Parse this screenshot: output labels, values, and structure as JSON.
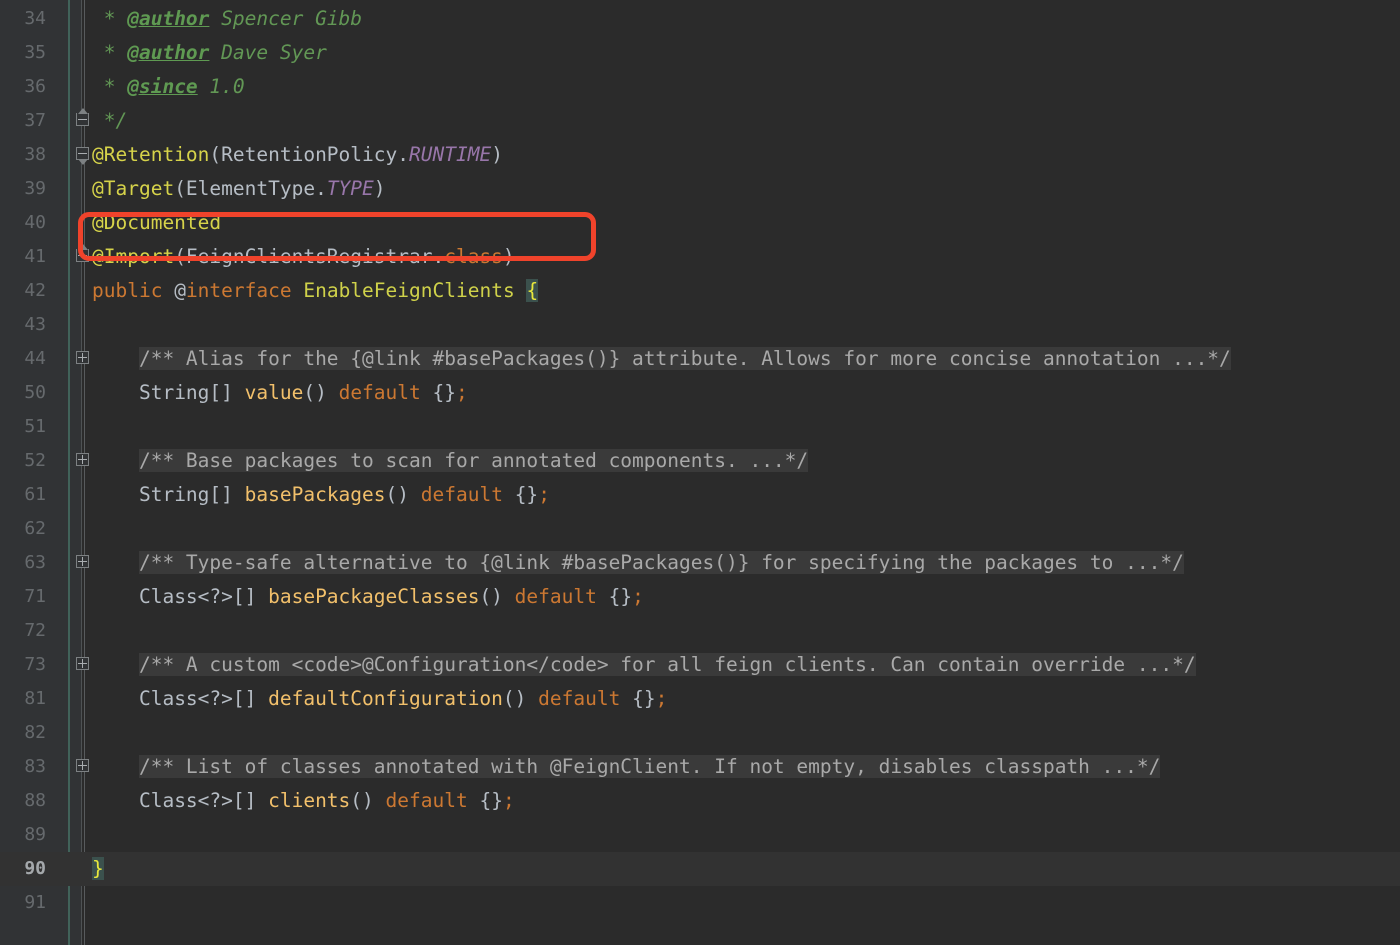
{
  "editor": {
    "file_language": "java",
    "theme": "darcula",
    "background": "#2b2b2b",
    "gutter_background": "#313335",
    "current_line_background": "#323232",
    "current_line_number": "90",
    "annotation_box_color": "#f0432b"
  },
  "lines": [
    {
      "number": "34",
      "fold": "none",
      "current": false,
      "text": " * @author Spencer Gibb",
      "tokens": [
        {
          "t": " * ",
          "c": "c-jdoctext"
        },
        {
          "t": "@author",
          "c": "c-jdoctag"
        },
        {
          "t": " Spencer Gibb",
          "c": "c-jdoctext"
        }
      ]
    },
    {
      "number": "35",
      "fold": "none",
      "current": false,
      "text": " * @author Dave Syer",
      "tokens": [
        {
          "t": " * ",
          "c": "c-jdoctext"
        },
        {
          "t": "@author",
          "c": "c-jdoctag"
        },
        {
          "t": " Dave Syer",
          "c": "c-jdoctext"
        }
      ]
    },
    {
      "number": "36",
      "fold": "none",
      "current": false,
      "text": " * @since 1.0",
      "tokens": [
        {
          "t": " * ",
          "c": "c-jdoctext"
        },
        {
          "t": "@since",
          "c": "c-jdoctag"
        },
        {
          "t": " 1.0",
          "c": "c-jdoctext"
        }
      ]
    },
    {
      "number": "37",
      "fold": "endfold",
      "current": false,
      "text": " */",
      "tokens": [
        {
          "t": " */",
          "c": "c-jdoctext"
        }
      ]
    },
    {
      "number": "38",
      "fold": "collapse",
      "current": false,
      "text": "@Retention(RetentionPolicy.RUNTIME)",
      "tokens": [
        {
          "t": "@Retention",
          "c": "c-annot"
        },
        {
          "t": "(RetentionPolicy.",
          "c": "c-ident"
        },
        {
          "t": "RUNTIME",
          "c": "c-static"
        },
        {
          "t": ")",
          "c": "c-ident"
        }
      ]
    },
    {
      "number": "39",
      "fold": "none",
      "current": false,
      "text": "@Target(ElementType.TYPE)",
      "tokens": [
        {
          "t": "@Target",
          "c": "c-annot"
        },
        {
          "t": "(ElementType.",
          "c": "c-ident"
        },
        {
          "t": "TYPE",
          "c": "c-static"
        },
        {
          "t": ")",
          "c": "c-ident"
        }
      ]
    },
    {
      "number": "40",
      "fold": "none",
      "current": false,
      "text": "@Documented",
      "tokens": [
        {
          "t": "@Documented",
          "c": "c-annot"
        }
      ]
    },
    {
      "number": "41",
      "fold": "endfold",
      "current": false,
      "text": "@Import(FeignClientsRegistrar.class)",
      "tokens": [
        {
          "t": "@Import",
          "c": "c-annot"
        },
        {
          "t": "(FeignClientsRegistrar.",
          "c": "c-ident"
        },
        {
          "t": "class",
          "c": "c-keyword"
        },
        {
          "t": ")",
          "c": "c-ident"
        }
      ]
    },
    {
      "number": "42",
      "fold": "none",
      "current": false,
      "text": "public @interface EnableFeignClients {",
      "tokens": [
        {
          "t": "public ",
          "c": "c-keyword"
        },
        {
          "t": "@",
          "c": "c-ident"
        },
        {
          "t": "interface",
          "c": "c-keyword"
        },
        {
          "t": " ",
          "c": "c-ident"
        },
        {
          "t": "EnableFeignClients",
          "c": "c-classname"
        },
        {
          "t": " ",
          "c": "c-ident"
        },
        {
          "t": "{",
          "c": "c-brace-match"
        }
      ]
    },
    {
      "number": "43",
      "fold": "none",
      "current": false,
      "text": "",
      "tokens": []
    },
    {
      "number": "44",
      "fold": "plus",
      "current": false,
      "text": "    /** Alias for the {@link #basePackages()} attribute. Allows for more concise annotation ...*/",
      "tokens": [
        {
          "t": "    ",
          "c": "c-punct"
        },
        {
          "t": "/** Alias for the {@link #basePackages()} attribute. Allows for more concise annotation ...*/",
          "c": "c-folded"
        }
      ]
    },
    {
      "number": "50",
      "fold": "none",
      "current": false,
      "text": "    String[] value() default {};",
      "tokens": [
        {
          "t": "    ",
          "c": "c-punct"
        },
        {
          "t": "String[] ",
          "c": "c-ident"
        },
        {
          "t": "value",
          "c": "c-method"
        },
        {
          "t": "() ",
          "c": "c-ident"
        },
        {
          "t": "default",
          "c": "c-keyword"
        },
        {
          "t": " {}",
          "c": "c-ident"
        },
        {
          "t": ";",
          "c": "c-semi"
        }
      ]
    },
    {
      "number": "51",
      "fold": "none",
      "current": false,
      "text": "",
      "tokens": []
    },
    {
      "number": "52",
      "fold": "plus",
      "current": false,
      "text": "    /** Base packages to scan for annotated components. ...*/",
      "tokens": [
        {
          "t": "    ",
          "c": "c-punct"
        },
        {
          "t": "/** Base packages to scan for annotated components. ...*/",
          "c": "c-folded"
        }
      ]
    },
    {
      "number": "61",
      "fold": "none",
      "current": false,
      "text": "    String[] basePackages() default {};",
      "tokens": [
        {
          "t": "    ",
          "c": "c-punct"
        },
        {
          "t": "String[] ",
          "c": "c-ident"
        },
        {
          "t": "basePackages",
          "c": "c-method"
        },
        {
          "t": "() ",
          "c": "c-ident"
        },
        {
          "t": "default",
          "c": "c-keyword"
        },
        {
          "t": " {}",
          "c": "c-ident"
        },
        {
          "t": ";",
          "c": "c-semi"
        }
      ]
    },
    {
      "number": "62",
      "fold": "none",
      "current": false,
      "text": "",
      "tokens": []
    },
    {
      "number": "63",
      "fold": "plus",
      "current": false,
      "text": "    /** Type-safe alternative to {@link #basePackages()} for specifying the packages to ...*/",
      "tokens": [
        {
          "t": "    ",
          "c": "c-punct"
        },
        {
          "t": "/** Type-safe alternative to {@link #basePackages()} for specifying the packages to ...*/",
          "c": "c-folded"
        }
      ]
    },
    {
      "number": "71",
      "fold": "none",
      "current": false,
      "text": "    Class<?>[] basePackageClasses() default {};",
      "tokens": [
        {
          "t": "    ",
          "c": "c-punct"
        },
        {
          "t": "Class<?>[] ",
          "c": "c-ident"
        },
        {
          "t": "basePackageClasses",
          "c": "c-method"
        },
        {
          "t": "() ",
          "c": "c-ident"
        },
        {
          "t": "default",
          "c": "c-keyword"
        },
        {
          "t": " {}",
          "c": "c-ident"
        },
        {
          "t": ";",
          "c": "c-semi"
        }
      ]
    },
    {
      "number": "72",
      "fold": "none",
      "current": false,
      "text": "",
      "tokens": []
    },
    {
      "number": "73",
      "fold": "plus",
      "current": false,
      "text": "    /** A custom <code>@Configuration</code> for all feign clients. Can contain override ...*/",
      "tokens": [
        {
          "t": "    ",
          "c": "c-punct"
        },
        {
          "t": "/** A custom <code>@Configuration</code> for all feign clients. Can contain override ...*/",
          "c": "c-folded"
        }
      ]
    },
    {
      "number": "81",
      "fold": "none",
      "current": false,
      "text": "    Class<?>[] defaultConfiguration() default {};",
      "tokens": [
        {
          "t": "    ",
          "c": "c-punct"
        },
        {
          "t": "Class<?>[] ",
          "c": "c-ident"
        },
        {
          "t": "defaultConfiguration",
          "c": "c-method"
        },
        {
          "t": "() ",
          "c": "c-ident"
        },
        {
          "t": "default",
          "c": "c-keyword"
        },
        {
          "t": " {}",
          "c": "c-ident"
        },
        {
          "t": ";",
          "c": "c-semi"
        }
      ]
    },
    {
      "number": "82",
      "fold": "none",
      "current": false,
      "text": "",
      "tokens": []
    },
    {
      "number": "83",
      "fold": "plus",
      "current": false,
      "text": "    /** List of classes annotated with @FeignClient. If not empty, disables classpath ...*/",
      "tokens": [
        {
          "t": "    ",
          "c": "c-punct"
        },
        {
          "t": "/** List of classes annotated with @FeignClient. If not empty, disables classpath ...*/",
          "c": "c-folded"
        }
      ]
    },
    {
      "number": "88",
      "fold": "none",
      "current": false,
      "text": "    Class<?>[] clients() default {};",
      "tokens": [
        {
          "t": "    ",
          "c": "c-punct"
        },
        {
          "t": "Class<?>[] ",
          "c": "c-ident"
        },
        {
          "t": "clients",
          "c": "c-method"
        },
        {
          "t": "() ",
          "c": "c-ident"
        },
        {
          "t": "default",
          "c": "c-keyword"
        },
        {
          "t": " {}",
          "c": "c-ident"
        },
        {
          "t": ";",
          "c": "c-semi"
        }
      ]
    },
    {
      "number": "89",
      "fold": "none",
      "current": false,
      "text": "",
      "tokens": []
    },
    {
      "number": "90",
      "fold": "none",
      "current": true,
      "text": "}",
      "tokens": [
        {
          "t": "}",
          "c": "c-brace-match"
        }
      ]
    },
    {
      "number": "91",
      "fold": "none",
      "current": false,
      "text": "",
      "tokens": []
    }
  ]
}
